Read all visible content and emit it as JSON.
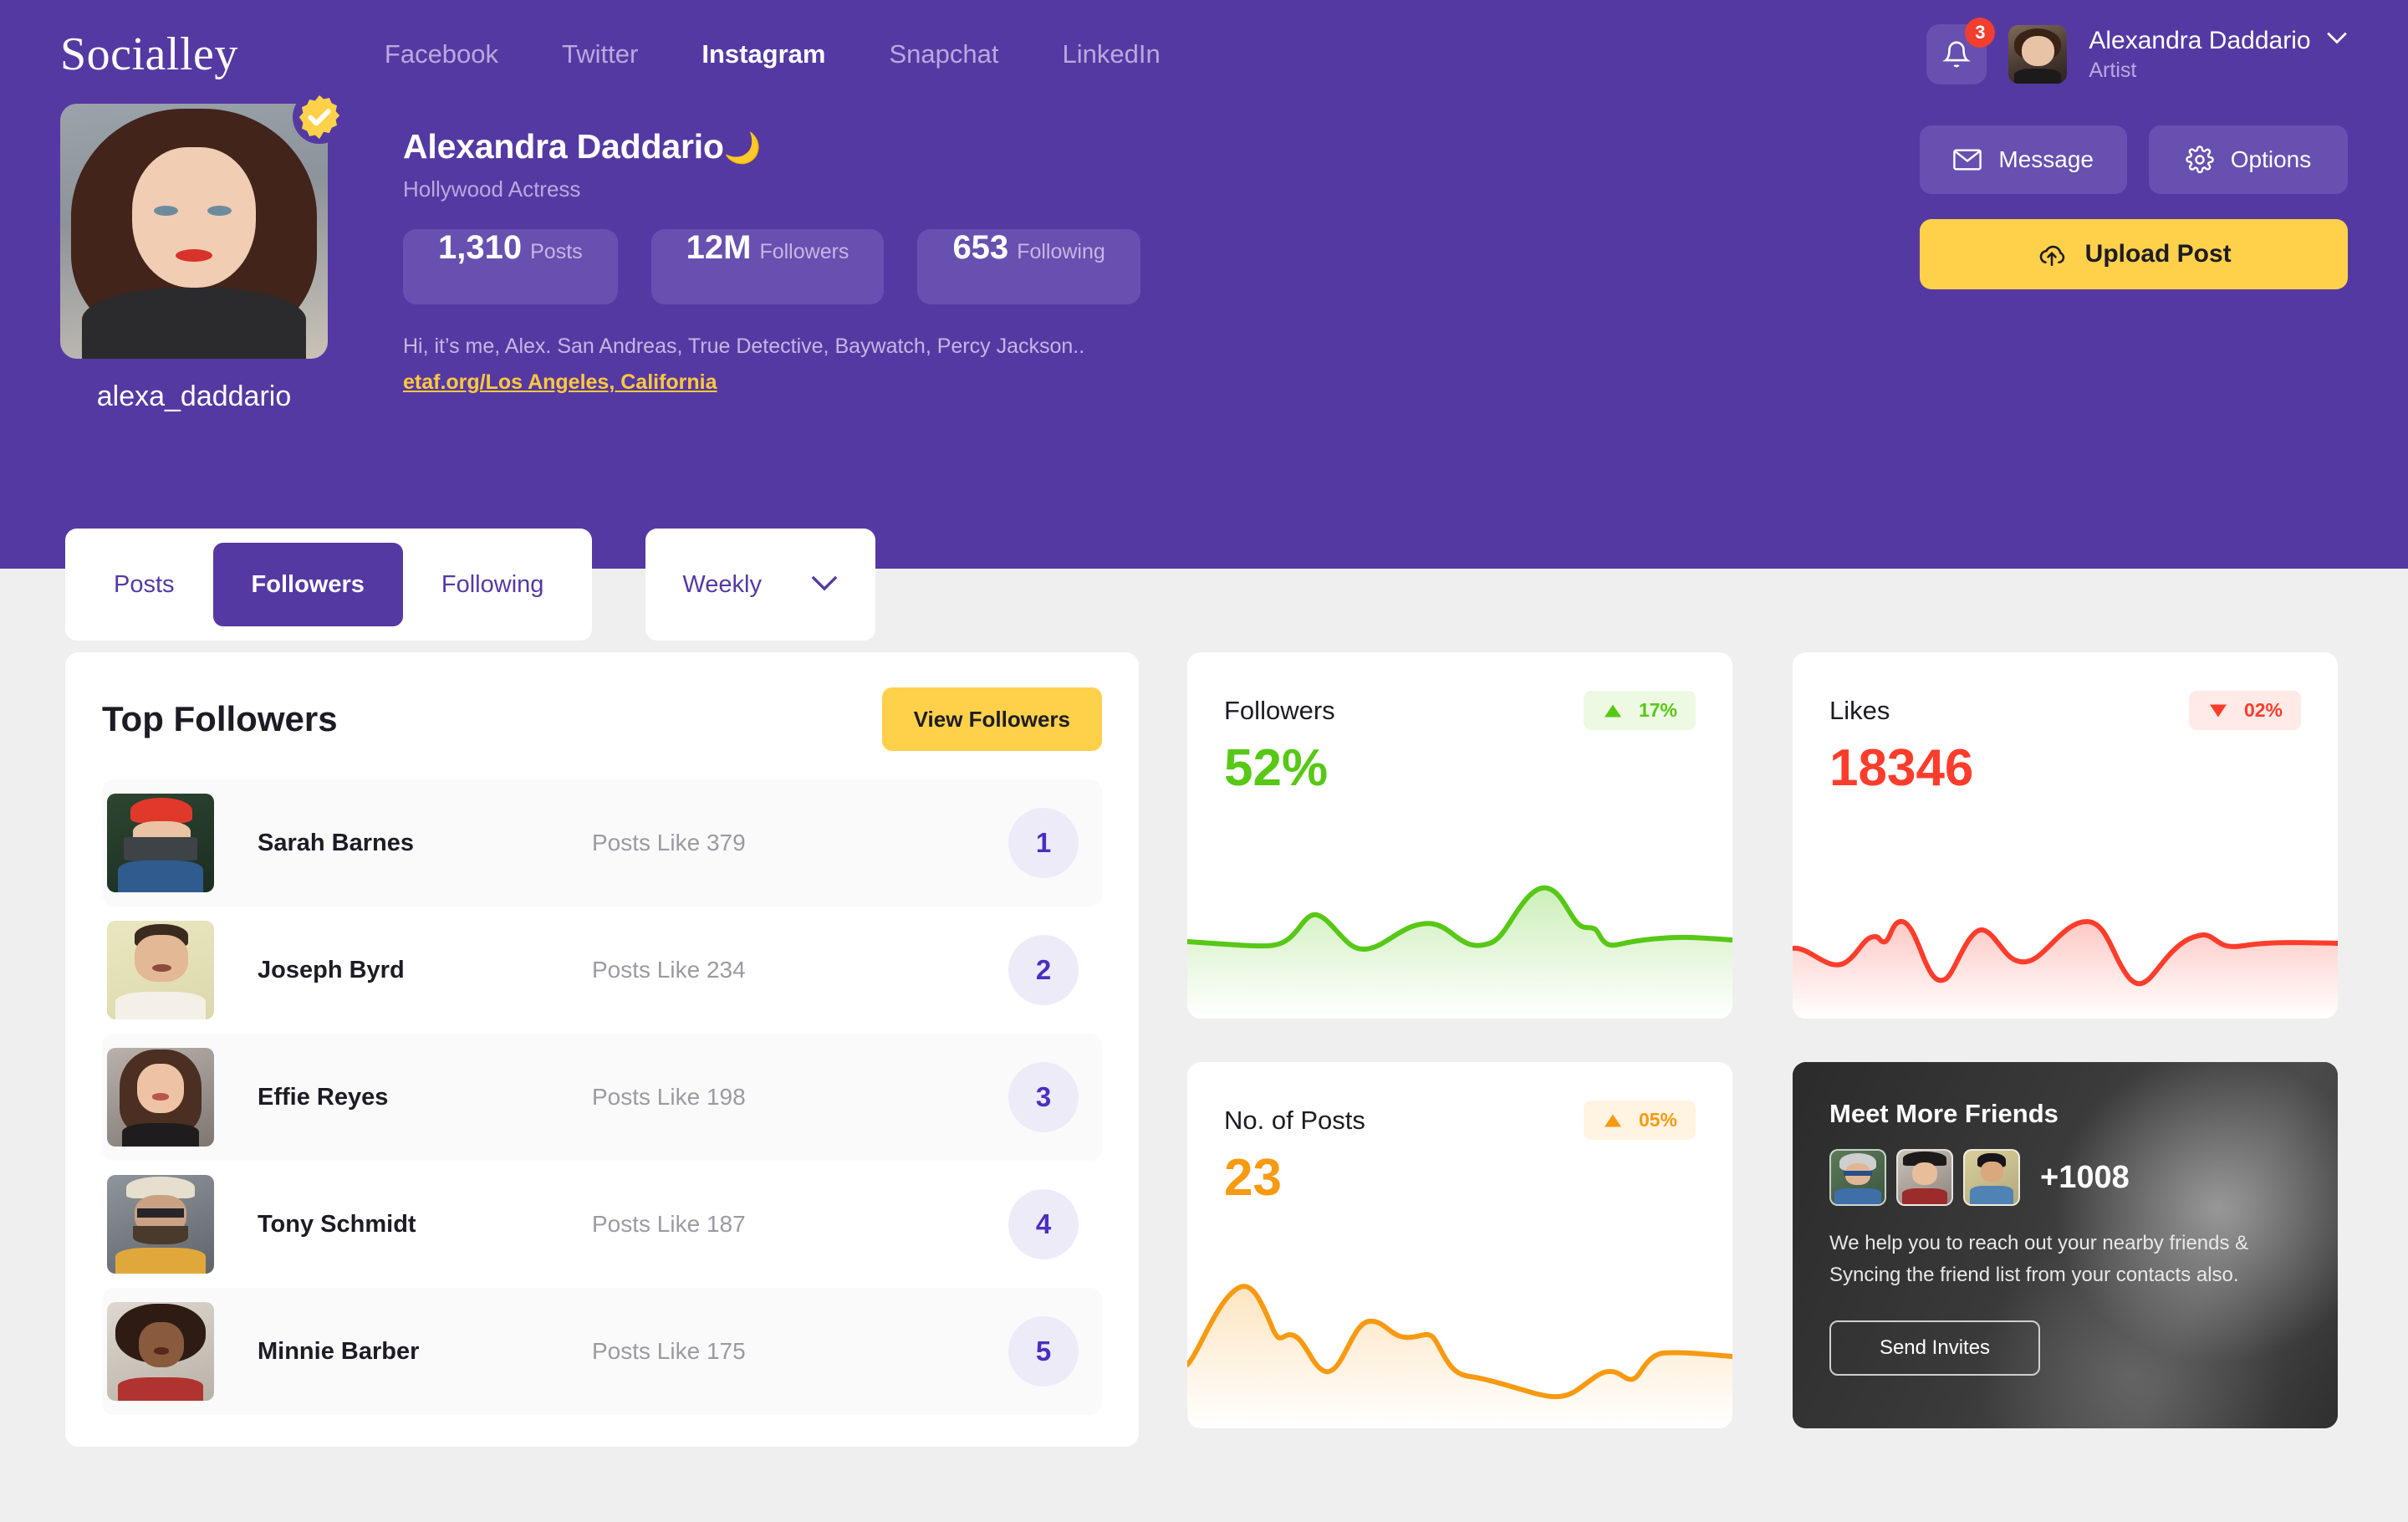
{
  "header": {
    "logo": "Socialley",
    "nav": [
      {
        "label": "Facebook",
        "active": false
      },
      {
        "label": "Twitter",
        "active": false
      },
      {
        "label": "Instagram",
        "active": true
      },
      {
        "label": "Snapchat",
        "active": false
      },
      {
        "label": "LinkedIn",
        "active": false
      }
    ],
    "notification_count": "3",
    "account_name": "Alexandra Daddario",
    "account_role": "Artist"
  },
  "profile": {
    "username": "alexa_daddario",
    "display_name": "Alexandra Daddario",
    "name_emoji": "🌙",
    "subtitle": "Hollywood Actress",
    "verified": true,
    "stats": [
      {
        "value": "1,310",
        "label": "Posts"
      },
      {
        "value": "12M",
        "label": "Followers"
      },
      {
        "value": "653",
        "label": "Following"
      }
    ],
    "bio": "Hi, it’s me, Alex. San Andreas, True Detective, Baywatch, Percy Jackson..",
    "link": "etaf.org/Los Angeles, California",
    "actions": {
      "message": "Message",
      "options": "Options",
      "upload": "Upload Post"
    }
  },
  "tabs": {
    "items": [
      {
        "label": "Posts",
        "active": false
      },
      {
        "label": "Followers",
        "active": true
      },
      {
        "label": "Following",
        "active": false
      }
    ],
    "period_selected": "Weekly"
  },
  "top_followers": {
    "title": "Top Followers",
    "view_button": "View Followers",
    "rows": [
      {
        "name": "Sarah Barnes",
        "posts": "Posts Like 379",
        "rank": "1"
      },
      {
        "name": "Joseph Byrd",
        "posts": "Posts Like 234",
        "rank": "2"
      },
      {
        "name": "Effie Reyes",
        "posts": "Posts Like 198",
        "rank": "3"
      },
      {
        "name": "Tony Schmidt",
        "posts": "Posts Like 187",
        "rank": "4"
      },
      {
        "name": "Minnie Barber",
        "posts": "Posts Like 175",
        "rank": "5"
      }
    ]
  },
  "stat_cards": [
    {
      "title": "Followers",
      "value": "52%",
      "delta": "17%",
      "direction": "up",
      "color": "#57c816"
    },
    {
      "title": "Likes",
      "value": "18346",
      "delta": "02%",
      "direction": "down",
      "color": "#fc3d2c"
    },
    {
      "title": "No. of Posts",
      "value": "23",
      "delta": "05%",
      "direction": "up",
      "color": "#f79a12"
    }
  ],
  "friends_card": {
    "title": "Meet More Friends",
    "extra_count": "+1008",
    "description": "We help you to reach out your nearby friends & Syncing the friend list from your contacts also.",
    "button": "Send Invites"
  },
  "chart_data": [
    {
      "type": "area",
      "title": "Followers",
      "series": [
        {
          "name": "Followers",
          "values": [
            32,
            30,
            29,
            29,
            30,
            48,
            62,
            50,
            36,
            32,
            40,
            55,
            57,
            48,
            36,
            35,
            52,
            78,
            82,
            62,
            48,
            50,
            34,
            33,
            38,
            41,
            42,
            41
          ]
        }
      ],
      "x": [
        0,
        1,
        2,
        3,
        4,
        5,
        6,
        7,
        8,
        9,
        10,
        11,
        12,
        13,
        14,
        15,
        16,
        17,
        18,
        19,
        20,
        21,
        22,
        23,
        24,
        25,
        26,
        27
      ],
      "color": "#57c816",
      "grid": false,
      "legend": "none",
      "ylim": [
        0,
        100
      ]
    },
    {
      "type": "area",
      "title": "Likes",
      "series": [
        {
          "name": "Likes",
          "values": [
            38,
            28,
            22,
            24,
            36,
            44,
            42,
            52,
            58,
            36,
            12,
            20,
            38,
            52,
            48,
            36,
            32,
            40,
            52,
            58,
            56,
            36,
            12,
            22,
            38,
            46,
            44,
            40,
            42,
            44
          ]
        }
      ],
      "x": [
        0,
        1,
        2,
        3,
        4,
        5,
        6,
        7,
        8,
        9,
        10,
        11,
        12,
        13,
        14,
        15,
        16,
        17,
        18,
        19,
        20,
        21,
        22,
        23,
        24,
        25,
        26,
        27,
        28,
        29
      ],
      "color": "#fc3d2c",
      "grid": false,
      "legend": "none",
      "ylim": [
        0,
        100
      ]
    },
    {
      "type": "area",
      "title": "No. of Posts",
      "series": [
        {
          "name": "Posts",
          "values": [
            30,
            62,
            88,
            72,
            60,
            58,
            44,
            38,
            52,
            68,
            60,
            58,
            56,
            36,
            26,
            22,
            18,
            14,
            16,
            24,
            30,
            28,
            36,
            44,
            46,
            45,
            44,
            44
          ]
        }
      ],
      "x": [
        0,
        1,
        2,
        3,
        4,
        5,
        6,
        7,
        8,
        9,
        10,
        11,
        12,
        13,
        14,
        15,
        16,
        17,
        18,
        19,
        20,
        21,
        22,
        23,
        24,
        25,
        26,
        27
      ],
      "color": "#f79a12",
      "grid": false,
      "legend": "none",
      "ylim": [
        0,
        100
      ]
    }
  ],
  "colors": {
    "brand_purple": "#5539A3",
    "brand_purple_light": "#6850b0",
    "accent_yellow": "#FFD14A",
    "green": "#57c816",
    "red": "#fc3d2c",
    "orange": "#f79a12",
    "page_bg": "#efefef"
  }
}
